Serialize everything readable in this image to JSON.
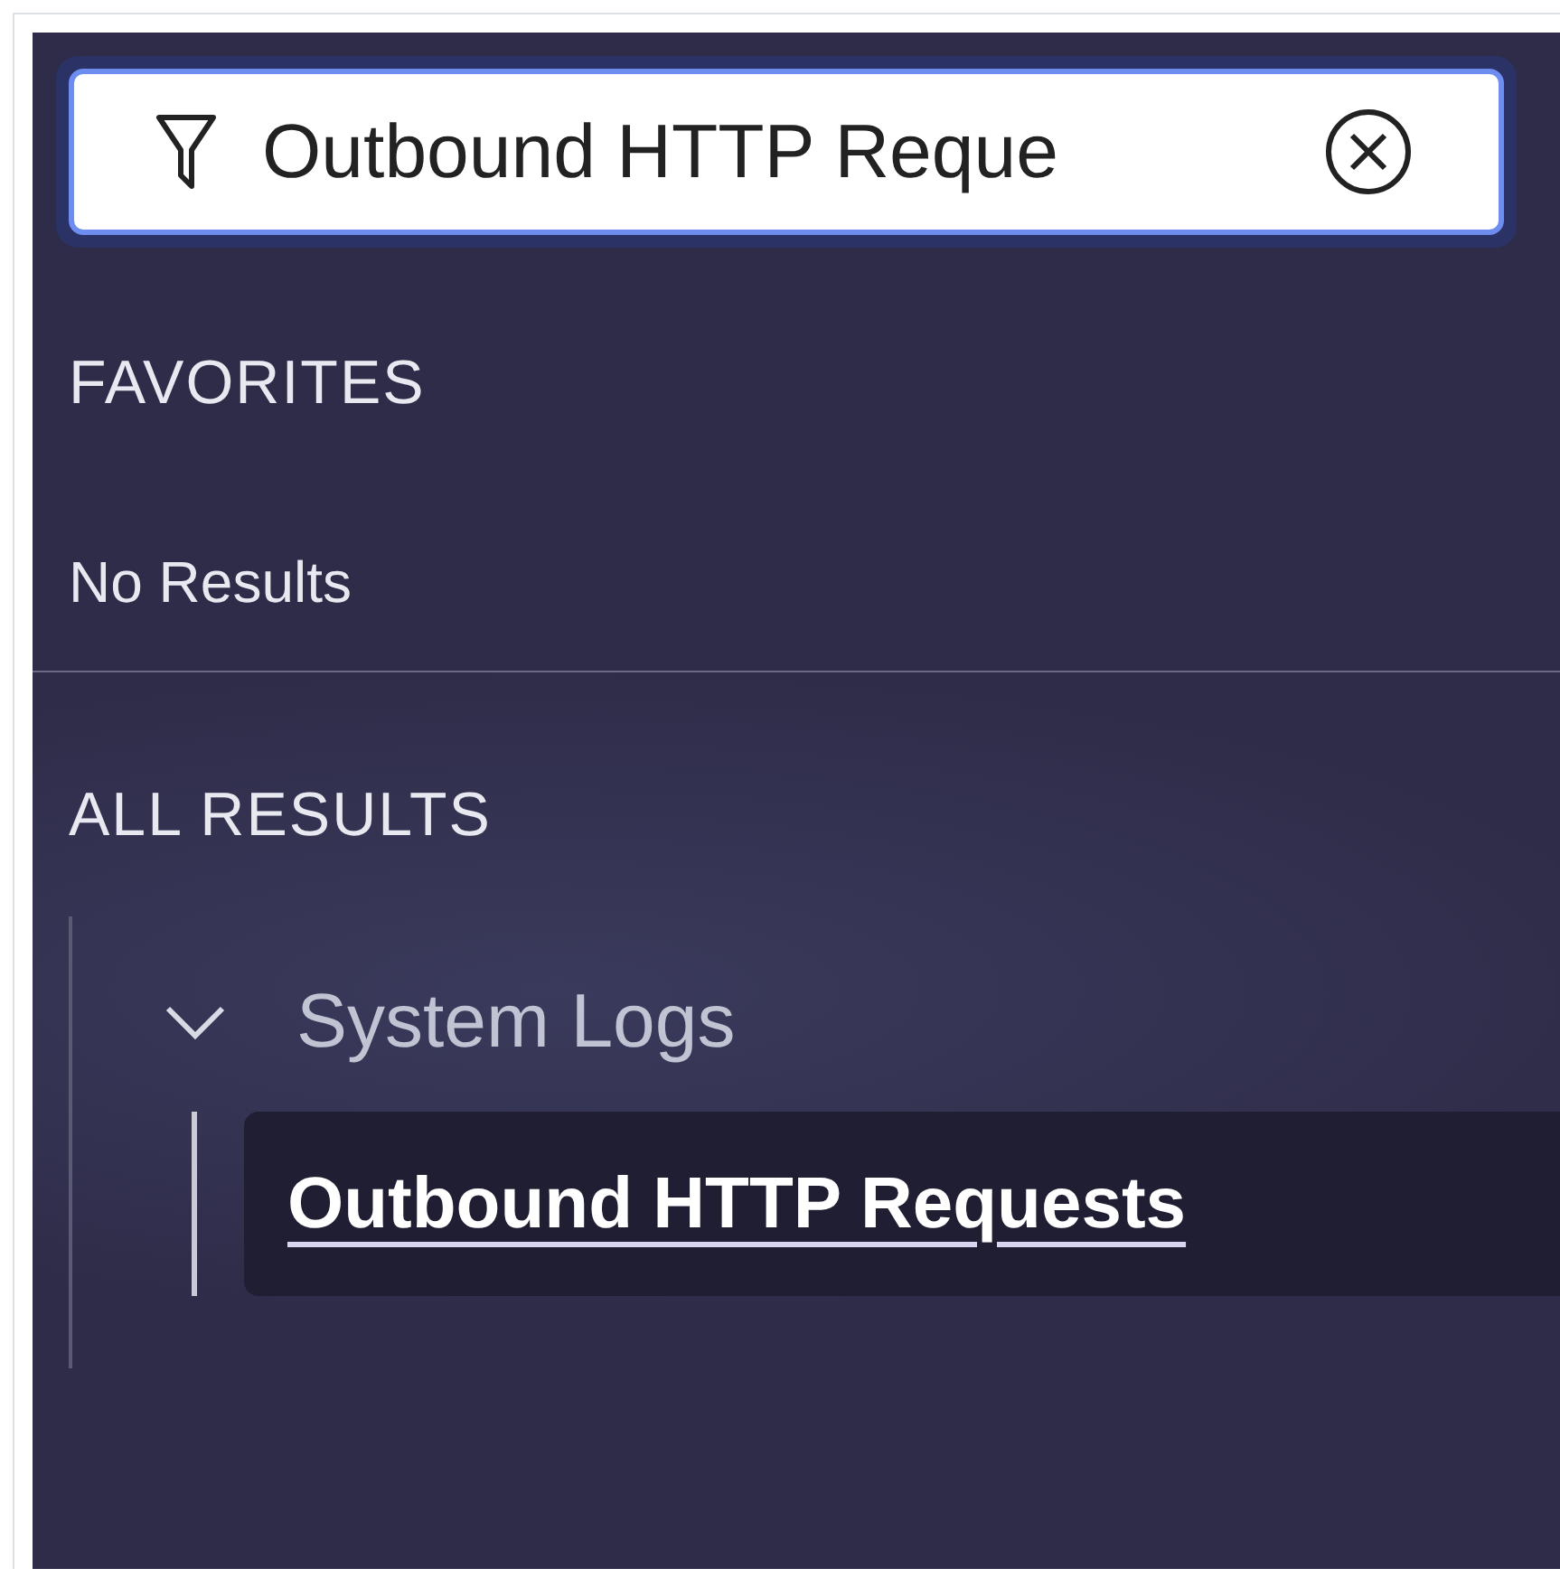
{
  "search": {
    "value": "Outbound HTTP Reque"
  },
  "favorites": {
    "title": "FAVORITES",
    "empty_text": "No Results"
  },
  "all_results": {
    "title": "ALL RESULTS",
    "tree": [
      {
        "label": "System Logs",
        "expanded": true,
        "children": [
          {
            "label": "Outbound HTTP Requests",
            "selected": true
          }
        ]
      }
    ]
  }
}
